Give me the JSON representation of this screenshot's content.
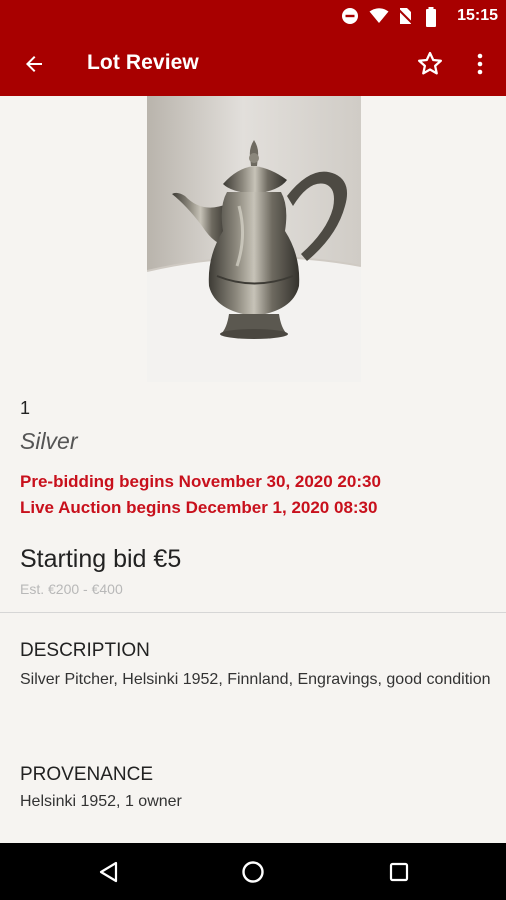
{
  "status_bar": {
    "time": "15:15",
    "icons": [
      "do-not-disturb-icon",
      "wifi-icon",
      "no-sim-icon",
      "battery-icon"
    ]
  },
  "app_bar": {
    "title": "Lot Review",
    "back_icon": "arrow-left-icon",
    "favorite_icon": "star-outline-icon",
    "menu_icon": "more-vertical-icon",
    "color": "#a80000"
  },
  "lot": {
    "number": "1",
    "name": "Silver",
    "pre_bidding": "Pre-bidding begins November 30, 2020  20:30",
    "live_auction": "Live Auction begins December 1, 2020  08:30",
    "starting_bid": "Starting bid €5",
    "estimate": "Est. €200 - €400",
    "alert_color": "#c8101c"
  },
  "description": {
    "heading": "DESCRIPTION",
    "text": "Silver Pitcher, Helsinki 1952, Finnland, Engravings, good condition"
  },
  "provenance": {
    "heading": "PROVENANCE",
    "text": "Helsinki 1952, 1 owner"
  },
  "nav_bar": {
    "icons": [
      "back-triangle-icon",
      "home-circle-icon",
      "recents-square-icon"
    ]
  }
}
